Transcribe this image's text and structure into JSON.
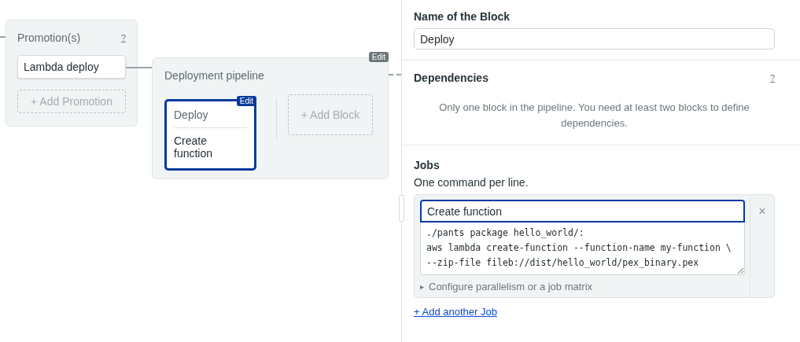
{
  "promotions": {
    "title": "Promotion(s)",
    "help": "?",
    "items": [
      "Lambda deploy"
    ],
    "add_label": "+ Add Promotion"
  },
  "pipeline": {
    "title": "Deployment pipeline",
    "edit_badge": "Edit",
    "blocks": [
      {
        "name": "Deploy",
        "jobs": [
          "Create function"
        ],
        "selected": true,
        "edit_badge": "Edit"
      }
    ],
    "add_block_label": "+ Add Block"
  },
  "editor": {
    "name_label": "Name of the Block",
    "name_value": "Deploy",
    "dependencies_label": "Dependencies",
    "dependencies_help": "?",
    "dependencies_note": "Only one block in the pipeline. You need at least two blocks to define dependencies.",
    "jobs_label": "Jobs",
    "jobs_hint": "One command per line.",
    "jobs": [
      {
        "name": "Create function",
        "focused": true,
        "remove": "×",
        "commands": [
          "./pants package hello_world/:",
          "aws lambda create-function --function-name my-function \\",
          "--zip-file fileb://dist/hello_world/pex_binary.pex"
        ],
        "matrix_toggle": "▸",
        "matrix_label": "Configure parallelism or a job matrix"
      }
    ],
    "add_job_label": "+ Add another Job"
  }
}
